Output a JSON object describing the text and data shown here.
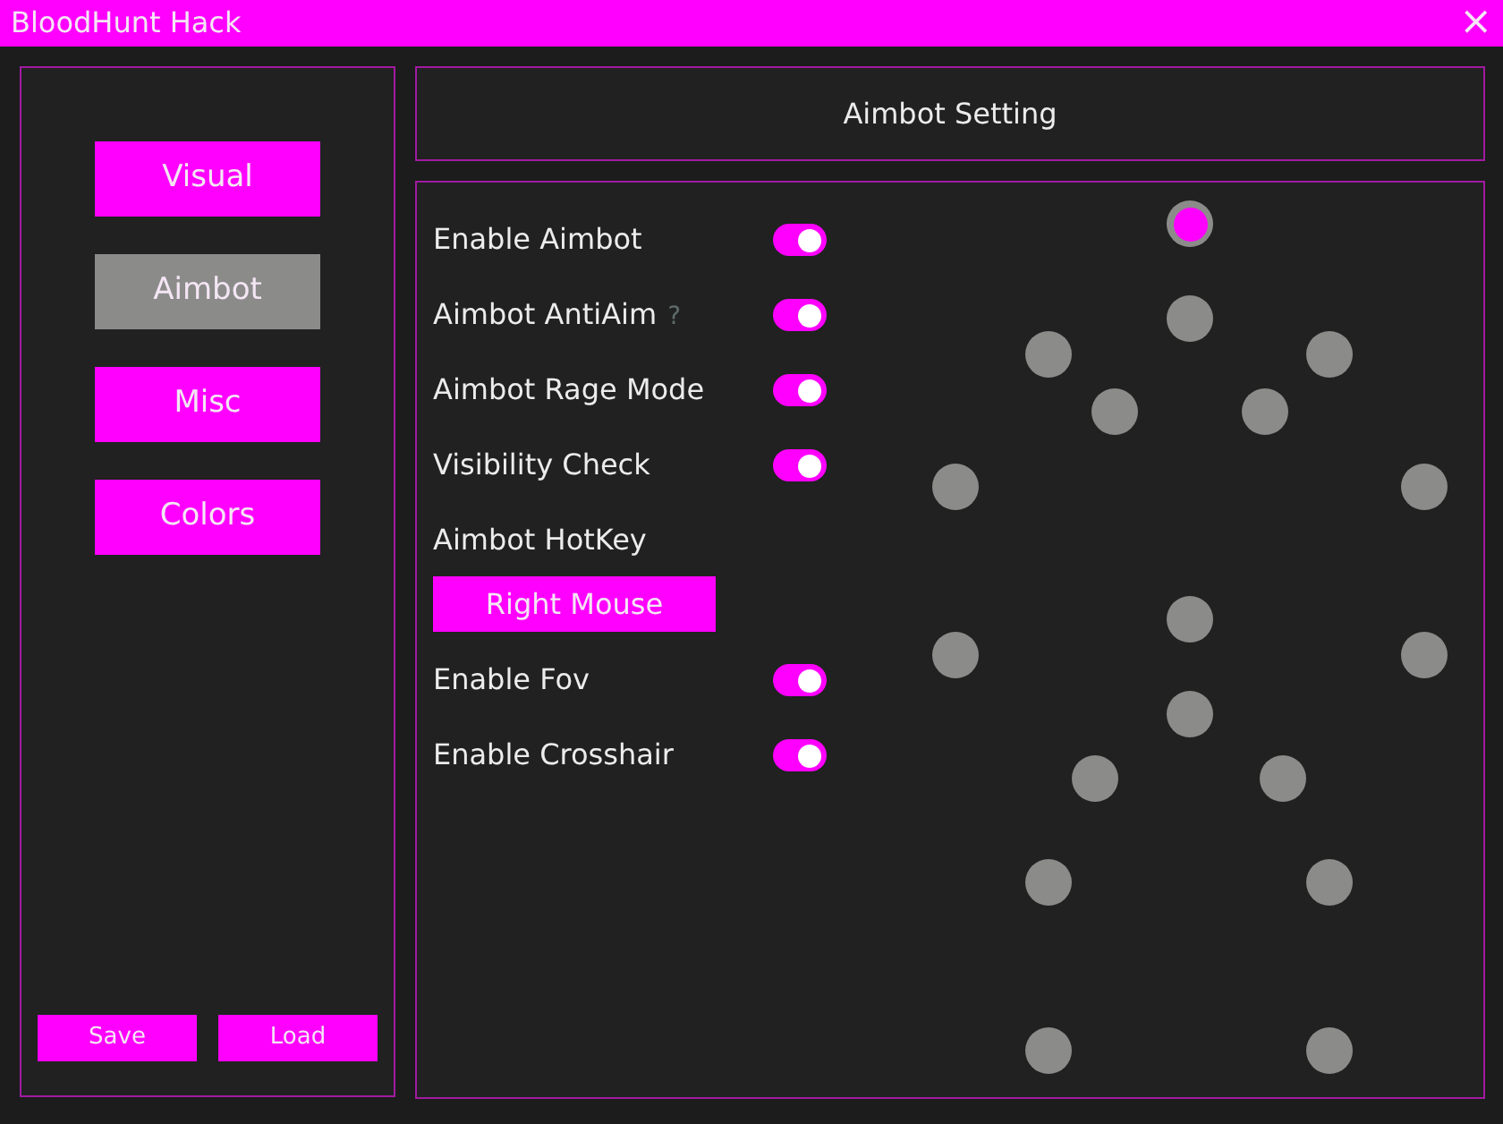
{
  "window": {
    "title": "BloodHunt Hack",
    "close": "×"
  },
  "sidebar": {
    "items": [
      {
        "label": "Visual",
        "selected": false
      },
      {
        "label": "Aimbot",
        "selected": true
      },
      {
        "label": "Misc",
        "selected": false
      },
      {
        "label": "Colors",
        "selected": false
      }
    ],
    "buttons": [
      "Save",
      "Load"
    ]
  },
  "header": {
    "title": "Aimbot Setting"
  },
  "settings": [
    {
      "kind": "toggle",
      "label": "Enable Aimbot",
      "on": true
    },
    {
      "kind": "toggle",
      "label": "Aimbot AntiAim",
      "hint": "?",
      "on": true
    },
    {
      "kind": "toggle",
      "label": "Aimbot Rage Mode",
      "on": true
    },
    {
      "kind": "toggle",
      "label": "Visibility Check",
      "on": true
    },
    {
      "kind": "hotkey",
      "label": "Aimbot HotKey",
      "value": "Right Mouse"
    },
    {
      "kind": "toggle",
      "label": "Enable Fov",
      "on": true
    },
    {
      "kind": "toggle",
      "label": "Enable Crosshair",
      "on": true
    }
  ],
  "bones": [
    {
      "selected": true
    },
    {
      "selected": false
    },
    {
      "selected": false
    },
    {
      "selected": false
    },
    {
      "selected": false
    },
    {
      "selected": false
    },
    {
      "selected": false
    },
    {
      "selected": false
    },
    {
      "selected": false
    },
    {
      "selected": false
    },
    {
      "selected": false
    },
    {
      "selected": false
    },
    {
      "selected": false
    },
    {
      "selected": false
    },
    {
      "selected": false
    },
    {
      "selected": false
    },
    {
      "selected": false
    },
    {
      "selected": false
    }
  ]
}
